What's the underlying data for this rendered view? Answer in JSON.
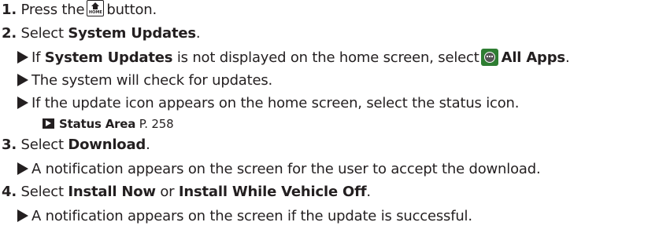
{
  "steps": [
    {
      "number": "1.",
      "pre": "Press the",
      "icon": "home-icon",
      "icon_text": "HOME",
      "post": "button."
    },
    {
      "number": "2.",
      "pre": "Select",
      "bold": "System Updates",
      "post": ".",
      "notes": [
        {
          "pre": "If",
          "bold": "System Updates",
          "mid": "is not displayed on the home screen, select",
          "icon": "all-apps-icon",
          "bold2": "All Apps",
          "post": "."
        },
        {
          "text": "The system will check for updates."
        },
        {
          "text": "If the update icon appears on the home screen, select the status icon."
        }
      ],
      "reference": {
        "icon": "cross-reference-arrow-icon",
        "bold": "Status Area",
        "page": "P. 258"
      }
    },
    {
      "number": "3.",
      "pre": "Select",
      "bold": "Download",
      "post": ".",
      "notes": [
        {
          "text": "A notification appears on the screen for the user to accept the download."
        }
      ]
    },
    {
      "number": "4.",
      "pre": "Select",
      "bold": "Install Now",
      "mid": "or",
      "bold2": "Install While Vehicle Off",
      "post": ".",
      "notes": [
        {
          "text": "A notification appears on the screen if the update is successful."
        }
      ]
    }
  ],
  "note_marker_icon": "triangle-bullet-icon"
}
